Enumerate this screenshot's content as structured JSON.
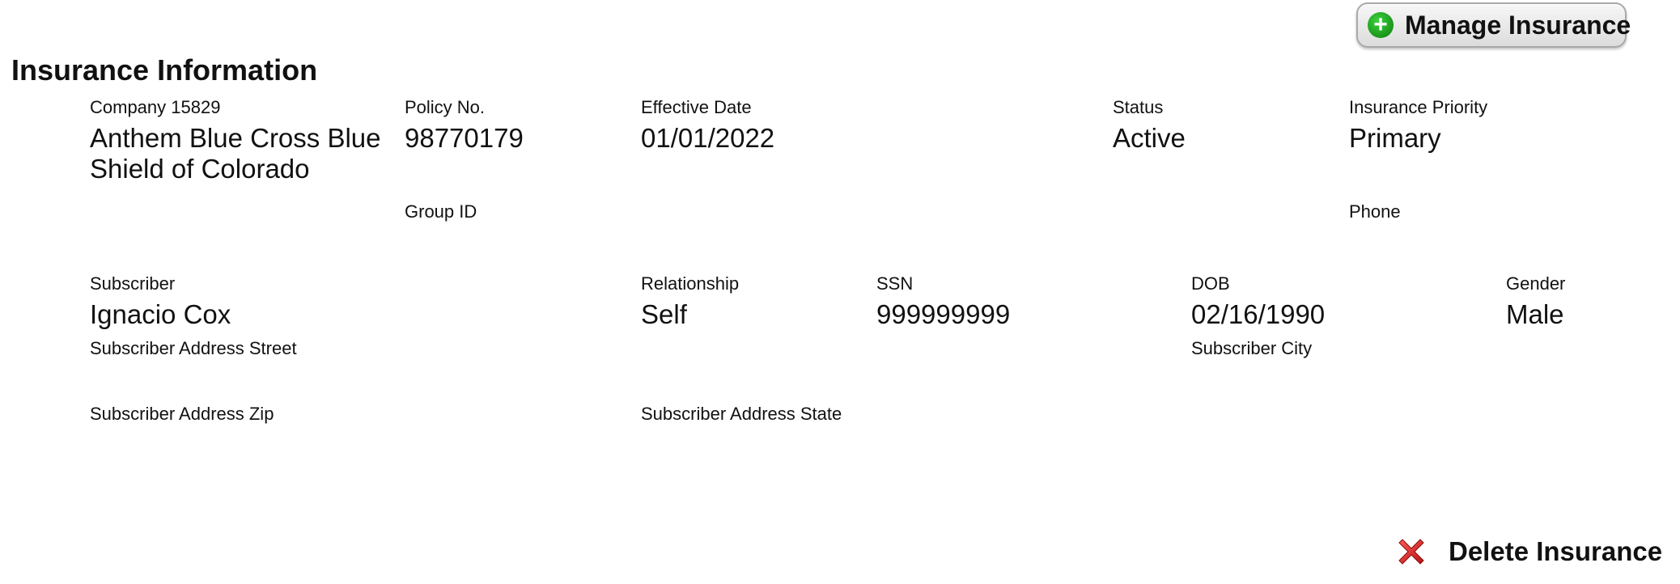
{
  "header": {
    "title": "Insurance Information",
    "manage_button": "Manage Insurance",
    "delete_button": "Delete Insurance"
  },
  "policy": {
    "company_label": "Company 15829",
    "company_value": "Anthem Blue Cross Blue Shield of Colorado",
    "policy_no_label": "Policy No.",
    "policy_no_value": "98770179",
    "effective_date_label": "Effective Date",
    "effective_date_value": "01/01/2022",
    "status_label": "Status",
    "status_value": "Active",
    "priority_label": "Insurance Priority",
    "priority_value": "Primary",
    "group_id_label": "Group ID",
    "phone_label": "Phone"
  },
  "subscriber": {
    "subscriber_label": "Subscriber",
    "subscriber_value": "Ignacio Cox",
    "relationship_label": "Relationship",
    "relationship_value": "Self",
    "ssn_label": "SSN",
    "ssn_value": "999999999",
    "dob_label": "DOB",
    "dob_value": "02/16/1990",
    "gender_label": "Gender",
    "gender_value": "Male",
    "address_street_label": "Subscriber Address Street",
    "city_label": "Subscriber City",
    "address_zip_label": "Subscriber Address Zip",
    "address_state_label": "Subscriber Address State"
  },
  "icons": {
    "manage": "plus-circle-icon",
    "delete": "red-x-icon"
  },
  "colors": {
    "plus_green": "#15a315",
    "delete_red": "#d62020"
  }
}
